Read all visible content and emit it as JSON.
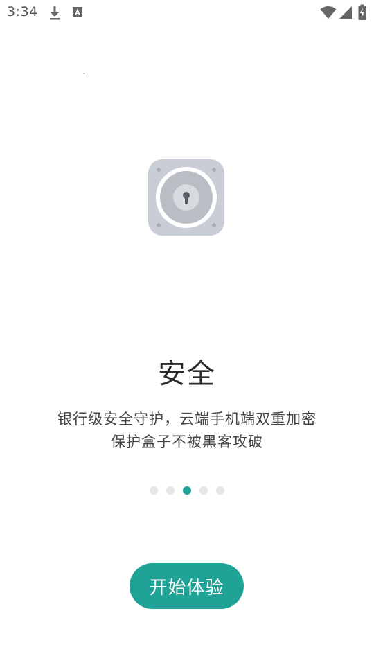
{
  "status_bar": {
    "time": "3:34"
  },
  "onboarding": {
    "title": "安全",
    "description_line1": "银行级安全守护，云端手机端双重加密",
    "description_line2": "保护盒子不被黑客攻破",
    "page_count": 5,
    "active_page": 3
  },
  "start_button": {
    "label": "开始体验"
  },
  "colors": {
    "accent": "#1fa397",
    "inactive_dot": "#e6e6e6",
    "lock_body": "#c9ced6"
  },
  "icons": {
    "status": [
      "download-icon",
      "text-a-icon",
      "wifi-icon",
      "signal-icon",
      "battery-icon"
    ],
    "hero": "lock-icon"
  }
}
